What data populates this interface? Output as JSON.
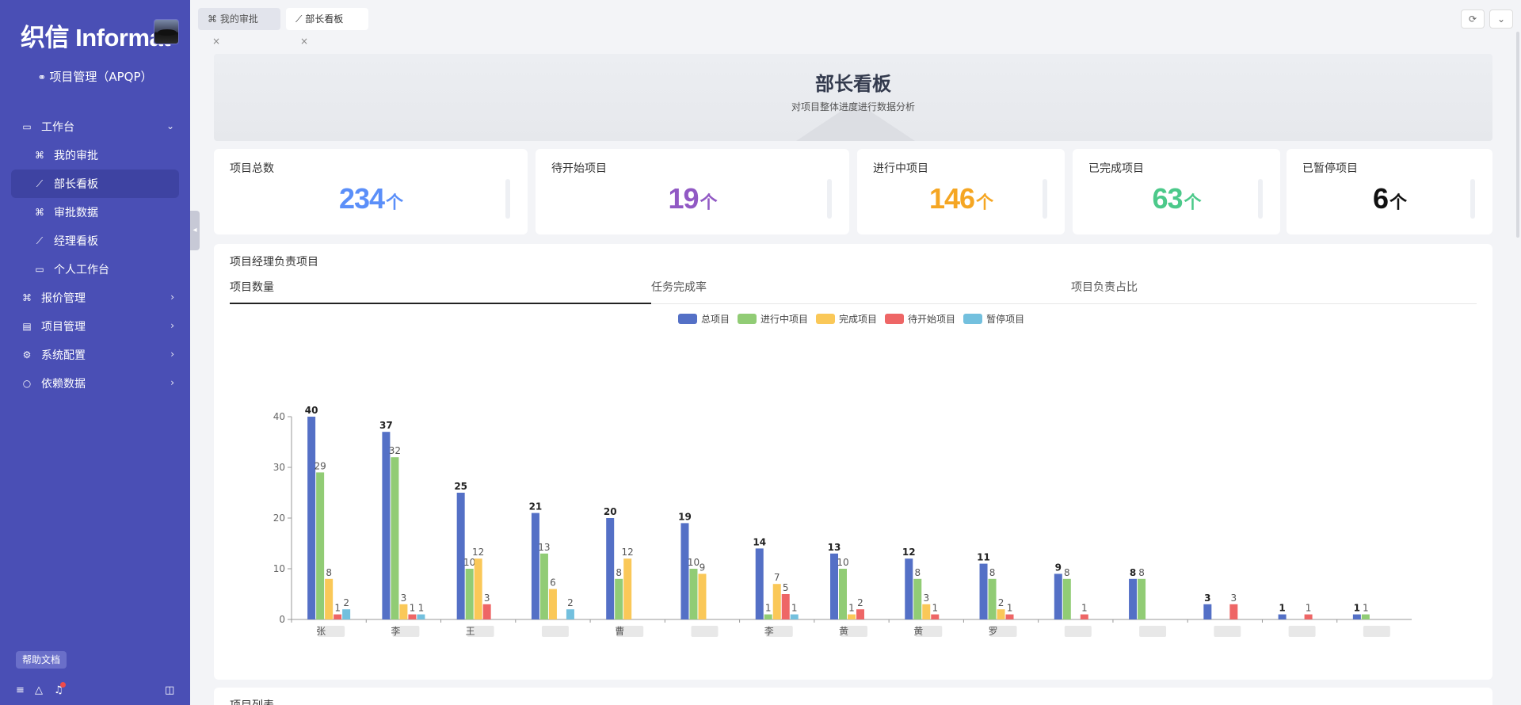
{
  "brand": {
    "logo_text": "织信 Informat",
    "app_title": "项目管理（APQP）"
  },
  "sidebar": {
    "groups": [
      {
        "label": "工作台",
        "expanded": true
      },
      {
        "label": "报价管理"
      },
      {
        "label": "项目管理"
      },
      {
        "label": "系统配置"
      },
      {
        "label": "依赖数据"
      }
    ],
    "subitems": [
      "我的审批",
      "部长看板",
      "审批数据",
      "经理看板",
      "个人工作台"
    ],
    "active_subitem": "部长看板",
    "help_label": "帮助文档"
  },
  "tabs": [
    {
      "label": "我的审批",
      "active": false
    },
    {
      "label": "部长看板",
      "active": true
    }
  ],
  "hero": {
    "title": "部长看板",
    "subtitle": "对项目整体进度进行数据分析"
  },
  "stats": [
    {
      "label": "项目总数",
      "value": "234",
      "unit": "个",
      "color": "#5b8ff9"
    },
    {
      "label": "待开始项目",
      "value": "19",
      "unit": "个",
      "color": "#9159c4"
    },
    {
      "label": "进行中项目",
      "value": "146",
      "unit": "个",
      "color": "#f5a623"
    },
    {
      "label": "已完成项目",
      "value": "63",
      "unit": "个",
      "color": "#4cc98a"
    },
    {
      "label": "已暂停项目",
      "value": "6",
      "unit": "个",
      "color": "#111111"
    }
  ],
  "panel": {
    "title": "项目经理负责项目",
    "subtabs": [
      "项目数量",
      "任务完成率",
      "项目负责占比"
    ],
    "active_subtab": "项目数量"
  },
  "list_title": "项目列表",
  "chart_data": {
    "type": "bar",
    "categories": [
      "张",
      "李",
      "王",
      "",
      "曹",
      "",
      "李",
      "黄",
      "黄",
      "罗",
      "",
      "",
      "",
      "",
      ""
    ],
    "series": [
      {
        "name": "总项目",
        "color": "#5470c6",
        "values": [
          40,
          37,
          25,
          21,
          20,
          19,
          14,
          13,
          12,
          11,
          9,
          8,
          3,
          1,
          1
        ]
      },
      {
        "name": "进行中项目",
        "color": "#91cc75",
        "values": [
          29,
          32,
          10,
          13,
          8,
          10,
          1,
          10,
          8,
          8,
          8,
          8,
          null,
          null,
          1
        ]
      },
      {
        "name": "完成项目",
        "color": "#fac858",
        "values": [
          8,
          3,
          12,
          6,
          12,
          9,
          7,
          1,
          3,
          2,
          null,
          null,
          null,
          null,
          null
        ]
      },
      {
        "name": "待开始项目",
        "color": "#ee6666",
        "values": [
          1,
          1,
          3,
          null,
          null,
          null,
          5,
          2,
          1,
          1,
          1,
          null,
          3,
          1,
          null
        ]
      },
      {
        "name": "暂停项目",
        "color": "#73c0de",
        "values": [
          2,
          1,
          null,
          2,
          null,
          null,
          1,
          null,
          null,
          null,
          null,
          null,
          null,
          null,
          null
        ]
      }
    ],
    "ylim": [
      0,
      40
    ],
    "yticks": [
      0,
      10,
      20,
      30,
      40
    ],
    "legend_position": "top-center",
    "grid": false
  }
}
